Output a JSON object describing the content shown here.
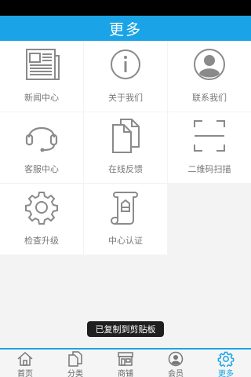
{
  "header": {
    "title": "更多"
  },
  "grid": {
    "items": [
      {
        "label": "新闻中心",
        "icon": "newspaper-icon"
      },
      {
        "label": "关于我们",
        "icon": "info-icon"
      },
      {
        "label": "联系我们",
        "icon": "contact-person-icon"
      },
      {
        "label": "客服中心",
        "icon": "headset-icon"
      },
      {
        "label": "在线反馈",
        "icon": "documents-icon"
      },
      {
        "label": "二维码扫描",
        "icon": "qr-scan-icon"
      },
      {
        "label": "检查升级",
        "icon": "gear-icon"
      },
      {
        "label": "中心认证",
        "icon": "certificate-scroll-icon"
      }
    ]
  },
  "toast": {
    "text": "已复制到剪贴板"
  },
  "tabbar": {
    "tabs": [
      {
        "label": "首页",
        "icon": "home-icon",
        "active": false
      },
      {
        "label": "分类",
        "icon": "category-icon",
        "active": false
      },
      {
        "label": "商铺",
        "icon": "shop-icon",
        "active": false
      },
      {
        "label": "会员",
        "icon": "member-icon",
        "active": false
      },
      {
        "label": "更多",
        "icon": "more-gear-icon",
        "active": true
      }
    ]
  },
  "colors": {
    "accent": "#1aa3e6",
    "icon_gray": "#8a8a8a",
    "label_gray": "#777777"
  }
}
